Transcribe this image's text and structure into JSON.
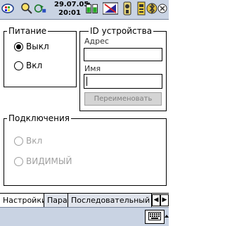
{
  "status": {
    "date": "29.07.05",
    "time": "20:01"
  },
  "power": {
    "title": "Питание",
    "options": [
      "Выкл",
      "Вкл"
    ],
    "selected": "Выкл"
  },
  "device": {
    "title": "ID устройства",
    "address_label": "Адрес",
    "address_value": "",
    "name_label": "Имя",
    "name_value": "",
    "rename_button": "Переименовать"
  },
  "connections": {
    "title": "Подключения",
    "options": [
      "Вкл",
      "ВИДИМЫЙ"
    ]
  },
  "tabs": [
    {
      "label": "Настройки"
    },
    {
      "label": "Пара"
    },
    {
      "label": "Последовательный п"
    }
  ],
  "icons": {
    "start": "windows-flag-icon",
    "search": "search-icon",
    "sync": "sync-icon",
    "battery": "battery-icon",
    "signal": "signal-icon",
    "volume": "speaker-icon",
    "connectivity": "phone-connection-icon",
    "bluetooth": "bluetooth-icon",
    "keyboard": "keyboard-icon"
  },
  "colors": {
    "bar_bg": "#c9d3e3",
    "disabled": "#a0a0a0"
  }
}
